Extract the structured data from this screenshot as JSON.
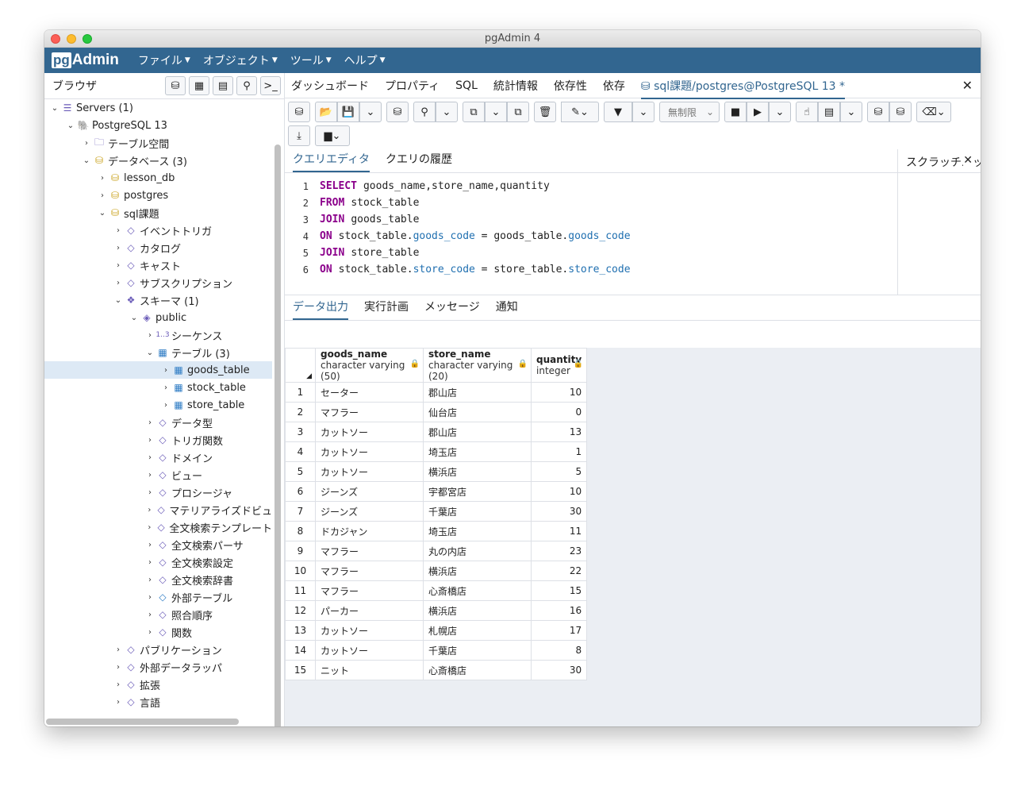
{
  "window": {
    "title": "pgAdmin 4"
  },
  "menubar": {
    "logo_pg": "pg",
    "logo_admin": "Admin",
    "items": [
      "ファイル",
      "オブジェクト",
      "ツール",
      "ヘルプ"
    ]
  },
  "browser": {
    "title": "ブラウザ",
    "tree": [
      {
        "label": "Servers (1)",
        "depth": 0,
        "expanded": true,
        "icon": "servers-icon"
      },
      {
        "label": "PostgreSQL 13",
        "depth": 1,
        "expanded": true,
        "icon": "elephant-icon"
      },
      {
        "label": "テーブル空間",
        "depth": 2,
        "expanded": false,
        "icon": "folder-icon"
      },
      {
        "label": "データベース (3)",
        "depth": 2,
        "expanded": true,
        "icon": "database-icon"
      },
      {
        "label": "lesson_db",
        "depth": 3,
        "expanded": false,
        "icon": "database-icon"
      },
      {
        "label": "postgres",
        "depth": 3,
        "expanded": false,
        "icon": "database-icon"
      },
      {
        "label": "sql課題",
        "depth": 3,
        "expanded": true,
        "icon": "database-icon"
      },
      {
        "label": "イベントトリガ",
        "depth": 4,
        "expanded": false,
        "icon": "event-trigger-icon"
      },
      {
        "label": "カタログ",
        "depth": 4,
        "expanded": false,
        "icon": "catalog-icon"
      },
      {
        "label": "キャスト",
        "depth": 4,
        "expanded": false,
        "icon": "cast-icon"
      },
      {
        "label": "サブスクリプション",
        "depth": 4,
        "expanded": false,
        "icon": "subscription-icon"
      },
      {
        "label": "スキーマ (1)",
        "depth": 4,
        "expanded": true,
        "icon": "schema-icon"
      },
      {
        "label": "public",
        "depth": 5,
        "expanded": true,
        "icon": "schema-public-icon"
      },
      {
        "label": "シーケンス",
        "depth": 6,
        "expanded": false,
        "icon": "sequence-icon"
      },
      {
        "label": "テーブル (3)",
        "depth": 6,
        "expanded": true,
        "icon": "tables-icon"
      },
      {
        "label": "goods_table",
        "depth": 7,
        "expanded": false,
        "icon": "table-icon",
        "selected": true
      },
      {
        "label": "stock_table",
        "depth": 7,
        "expanded": false,
        "icon": "table-icon"
      },
      {
        "label": "store_table",
        "depth": 7,
        "expanded": false,
        "icon": "table-icon"
      },
      {
        "label": "データ型",
        "depth": 6,
        "expanded": false,
        "icon": "datatype-icon"
      },
      {
        "label": "トリガ関数",
        "depth": 6,
        "expanded": false,
        "icon": "trigger-function-icon"
      },
      {
        "label": "ドメイン",
        "depth": 6,
        "expanded": false,
        "icon": "domain-icon"
      },
      {
        "label": "ビュー",
        "depth": 6,
        "expanded": false,
        "icon": "view-icon"
      },
      {
        "label": "プロシージャ",
        "depth": 6,
        "expanded": false,
        "icon": "procedure-icon"
      },
      {
        "label": "マテリアライズドビュ",
        "depth": 6,
        "expanded": false,
        "icon": "materialized-view-icon"
      },
      {
        "label": "全文検索テンプレート",
        "depth": 6,
        "expanded": false,
        "icon": "fts-template-icon"
      },
      {
        "label": "全文検索パーサ",
        "depth": 6,
        "expanded": false,
        "icon": "fts-parser-icon"
      },
      {
        "label": "全文検索設定",
        "depth": 6,
        "expanded": false,
        "icon": "fts-config-icon"
      },
      {
        "label": "全文検索辞書",
        "depth": 6,
        "expanded": false,
        "icon": "fts-dictionary-icon"
      },
      {
        "label": "外部テーブル",
        "depth": 6,
        "expanded": false,
        "icon": "foreign-table-icon"
      },
      {
        "label": "照合順序",
        "depth": 6,
        "expanded": false,
        "icon": "collation-icon"
      },
      {
        "label": "関数",
        "depth": 6,
        "expanded": false,
        "icon": "function-icon"
      },
      {
        "label": "パブリケーション",
        "depth": 4,
        "expanded": false,
        "icon": "publication-icon"
      },
      {
        "label": "外部データラッパ",
        "depth": 4,
        "expanded": false,
        "icon": "fdw-icon"
      },
      {
        "label": "拡張",
        "depth": 4,
        "expanded": false,
        "icon": "extension-icon"
      },
      {
        "label": "言語",
        "depth": 4,
        "expanded": false,
        "icon": "language-icon"
      }
    ]
  },
  "tabs": {
    "items": [
      "ダッシュボード",
      "プロパティ",
      "SQL",
      "統計情報",
      "依存性",
      "依存"
    ],
    "active": "sql課題/postgres@PostgreSQL 13 *"
  },
  "toolbar": {
    "limit": "無制限"
  },
  "query_tabs": {
    "editor": "クエリエディタ",
    "history": "クエリの履歴",
    "scratch": "スクラッチパッド"
  },
  "editor": {
    "lines": [
      [
        {
          "t": "kw",
          "v": "SELECT"
        },
        {
          "t": "plain",
          "v": "goods_name,store_name,quantity"
        }
      ],
      [
        {
          "t": "kw",
          "v": "FROM"
        },
        {
          "t": "plain",
          "v": "stock_table"
        }
      ],
      [
        {
          "t": "kw",
          "v": "JOIN"
        },
        {
          "t": "plain",
          "v": "goods_table"
        }
      ],
      [
        {
          "t": "kw",
          "v": "ON"
        },
        {
          "t": "plain",
          "v": "stock_table."
        },
        {
          "t": "fld",
          "v": "goods_code"
        },
        {
          "t": "plain",
          "v": " = goods_table."
        },
        {
          "t": "fld",
          "v": "goods_code"
        }
      ],
      [
        {
          "t": "kw",
          "v": "JOIN"
        },
        {
          "t": "plain",
          "v": "store_table"
        }
      ],
      [
        {
          "t": "kw",
          "v": "ON"
        },
        {
          "t": "plain",
          "v": "stock_table."
        },
        {
          "t": "fld",
          "v": "store_code"
        },
        {
          "t": "plain",
          "v": " = store_table."
        },
        {
          "t": "fld",
          "v": "store_code"
        }
      ]
    ]
  },
  "result_tabs": [
    "データ出力",
    "実行計画",
    "メッセージ",
    "通知"
  ],
  "grid": {
    "columns": [
      {
        "name": "goods_name",
        "type": "character varying (50)"
      },
      {
        "name": "store_name",
        "type": "character varying (20)"
      },
      {
        "name": "quantity",
        "type": "integer"
      }
    ],
    "rows": [
      [
        "セーター",
        "郡山店",
        "10"
      ],
      [
        "マフラー",
        "仙台店",
        "0"
      ],
      [
        "カットソー",
        "郡山店",
        "13"
      ],
      [
        "カットソー",
        "埼玉店",
        "1"
      ],
      [
        "カットソー",
        "横浜店",
        "5"
      ],
      [
        "ジーンズ",
        "宇都宮店",
        "10"
      ],
      [
        "ジーンズ",
        "千葉店",
        "30"
      ],
      [
        "ドカジャン",
        "埼玉店",
        "11"
      ],
      [
        "マフラー",
        "丸の内店",
        "23"
      ],
      [
        "マフラー",
        "横浜店",
        "22"
      ],
      [
        "マフラー",
        "心斎橋店",
        "15"
      ],
      [
        "パーカー",
        "横浜店",
        "16"
      ],
      [
        "カットソー",
        "札幌店",
        "17"
      ],
      [
        "カットソー",
        "千葉店",
        "8"
      ],
      [
        "ニット",
        "心斎橋店",
        "30"
      ]
    ]
  },
  "colors": {
    "brand": "#326690",
    "selected": "#dde9f5",
    "keyword": "#8b008b",
    "field": "#1f6fb0"
  }
}
